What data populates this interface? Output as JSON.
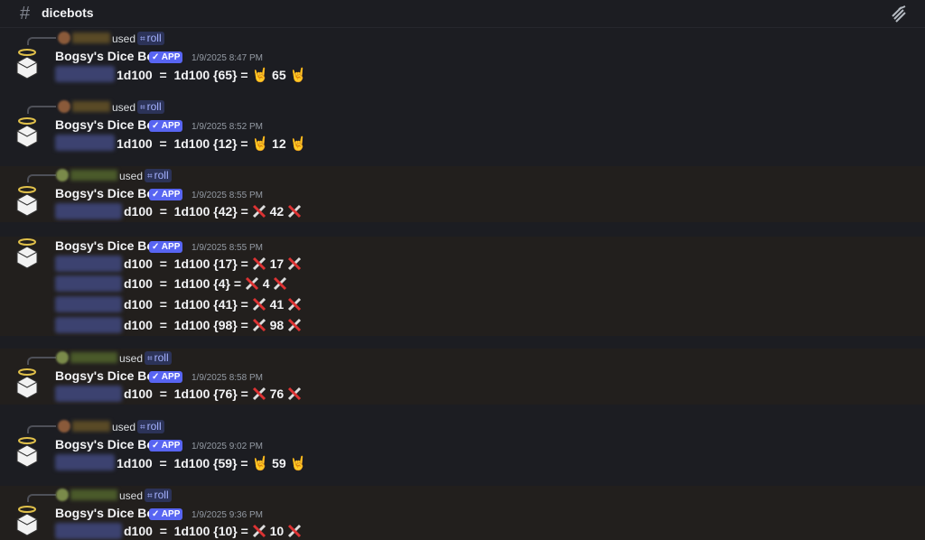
{
  "channel": {
    "name": "dicebots",
    "hash": "#"
  },
  "icons": {
    "channel": "hash-icon",
    "threads": "threads-icon",
    "avatar": "angel-die-icon",
    "crossed": "crossed-dice-icon",
    "rock": "rock-hand-emoji"
  },
  "colors": {
    "bg": "#1c1d22",
    "highlight": "#221f1d",
    "app_badge": "#5865f2",
    "mention": "#3c4270",
    "command": "#a4b1ff"
  },
  "messages": [
    {
      "used": "used",
      "command": "roll",
      "author": "Bogsy's Dice Bot",
      "badge": "APP",
      "time": "1/9/2025 8:47 PM",
      "lines": [
        {
          "expr": "1d100",
          "eq": "=",
          "roll": "1d100 {65} =",
          "result": "65"
        }
      ]
    },
    {
      "used": "used",
      "command": "roll",
      "author": "Bogsy's Dice Bot",
      "badge": "APP",
      "time": "1/9/2025 8:52 PM",
      "lines": [
        {
          "expr": "1d100",
          "eq": "=",
          "roll": "1d100 {12} =",
          "result": "12"
        }
      ]
    },
    {
      "used": "used",
      "command": "roll",
      "author": "Bogsy's Dice Bot",
      "badge": "APP",
      "time": "1/9/2025 8:55 PM",
      "lines": [
        {
          "expr": "d100",
          "eq": "=",
          "roll": "1d100 {42} =",
          "result": "42"
        }
      ]
    },
    {
      "author": "Bogsy's Dice Bot",
      "badge": "APP",
      "time": "1/9/2025 8:55 PM",
      "lines": [
        {
          "expr": "d100",
          "eq": "=",
          "roll": "1d100 {17} =",
          "result": "17"
        },
        {
          "expr": "d100",
          "eq": "=",
          "roll": "1d100 {4} =",
          "result": "4"
        },
        {
          "expr": "d100",
          "eq": "=",
          "roll": "1d100 {41} =",
          "result": "41"
        },
        {
          "expr": "d100",
          "eq": "=",
          "roll": "1d100 {98} =",
          "result": "98"
        }
      ]
    },
    {
      "used": "used",
      "command": "roll",
      "author": "Bogsy's Dice Bot",
      "badge": "APP",
      "time": "1/9/2025 8:58 PM",
      "lines": [
        {
          "expr": "d100",
          "eq": "=",
          "roll": "1d100 {76} =",
          "result": "76"
        }
      ]
    },
    {
      "used": "used",
      "command": "roll",
      "author": "Bogsy's Dice Bot",
      "badge": "APP",
      "time": "1/9/2025 9:02 PM",
      "lines": [
        {
          "expr": "1d100",
          "eq": "=",
          "roll": "1d100 {59} =",
          "result": "59"
        }
      ]
    },
    {
      "used": "used",
      "command": "roll",
      "author": "Bogsy's Dice Bot",
      "badge": "APP",
      "time": "1/9/2025 9:36 PM",
      "lines": [
        {
          "expr": "d100",
          "eq": "=",
          "roll": "1d100 {10} =",
          "result": "10"
        }
      ]
    }
  ]
}
